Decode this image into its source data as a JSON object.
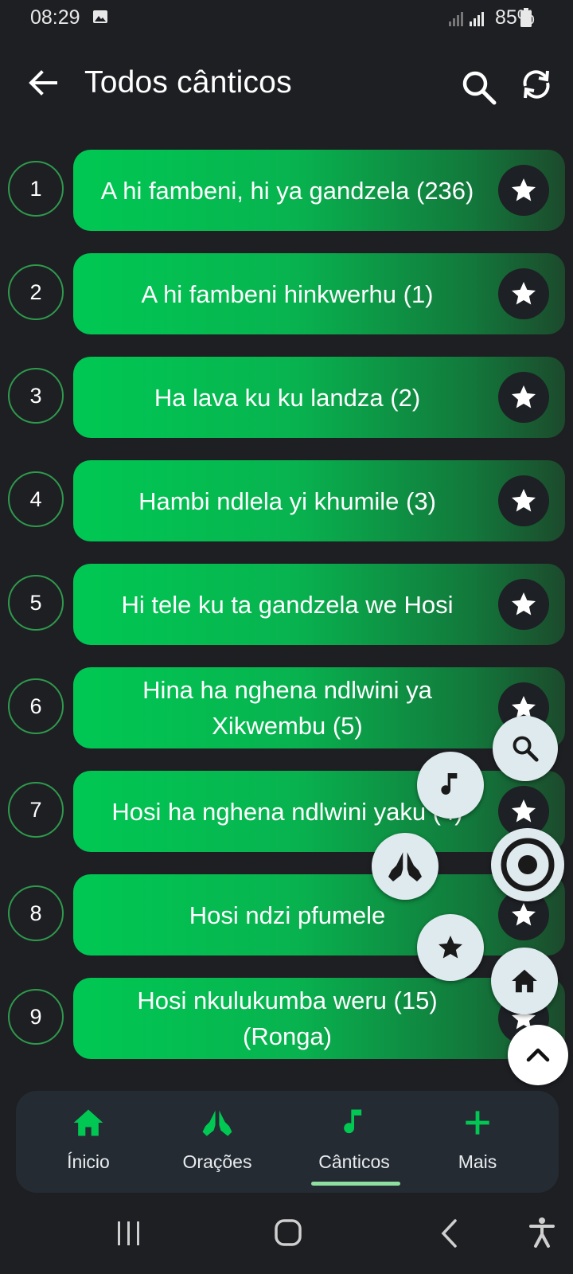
{
  "status": {
    "time": "08:29",
    "battery": "85%"
  },
  "appbar": {
    "title": "Todos cânticos"
  },
  "songs": [
    {
      "number": "1",
      "title": "A hi fambeni, hi ya gandzela (236)"
    },
    {
      "number": "2",
      "title": "A hi fambeni hinkwerhu (1)"
    },
    {
      "number": "3",
      "title": "Ha lava ku ku landza (2)"
    },
    {
      "number": "4",
      "title": "Hambi ndlela yi khumile (3)"
    },
    {
      "number": "5",
      "title": "Hi tele ku ta gandzela we Hosi"
    },
    {
      "number": "6",
      "title": "Hina ha nghena ndlwini ya Xikwembu (5)"
    },
    {
      "number": "7",
      "title": "Hosi ha nghena ndlwini yaku (4)"
    },
    {
      "number": "8",
      "title": "Hosi ndzi pfumele"
    },
    {
      "number": "9",
      "title": "Hosi nkulukumba weru (15) (Ronga)"
    }
  ],
  "speed_dial": [
    "search-icon",
    "music-note-icon",
    "praying-hands-icon",
    "radio-target-icon",
    "star-icon",
    "home-icon",
    "chevron-up-icon"
  ],
  "nav": {
    "items": [
      {
        "label": "Ínicio",
        "icon": "home-icon"
      },
      {
        "label": "Orações",
        "icon": "praying-hands-icon"
      },
      {
        "label": "Cânticos",
        "icon": "music-note-icon"
      },
      {
        "label": "Mais",
        "icon": "plus-icon"
      }
    ],
    "active": "Cânticos"
  },
  "colors": {
    "accent": "#00c853",
    "background": "#1e1f23",
    "nav_background": "#252b33"
  }
}
